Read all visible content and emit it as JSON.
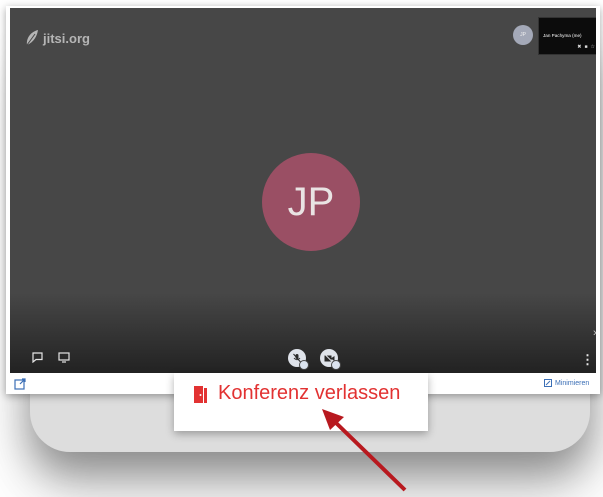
{
  "logo": {
    "text": "jitsi.org",
    "icon": "jitsi-leaf-icon"
  },
  "self_view": {
    "avatar_text": "JP",
    "thumbnail_name": "Jan Pachyma (me)"
  },
  "main_participant": {
    "initials": "JP",
    "color": "#9a4f64"
  },
  "toolbar": {
    "chat_icon": "chat-icon",
    "screenshare_icon": "screenshare-icon",
    "mic_icon": "mic-off-icon",
    "camera_icon": "camera-off-icon",
    "more_icon": "more-vertical-icon",
    "more_glyph": "⋮"
  },
  "footer": {
    "open_external_icon": "open-external-icon",
    "minimize_label": "Minimieren"
  },
  "callout": {
    "leave_label": "Konferenz verlassen",
    "accent": "#e23232"
  },
  "colors": {
    "stage": "#474747",
    "arrow": "#b8191f",
    "link": "#3b6fb6"
  }
}
